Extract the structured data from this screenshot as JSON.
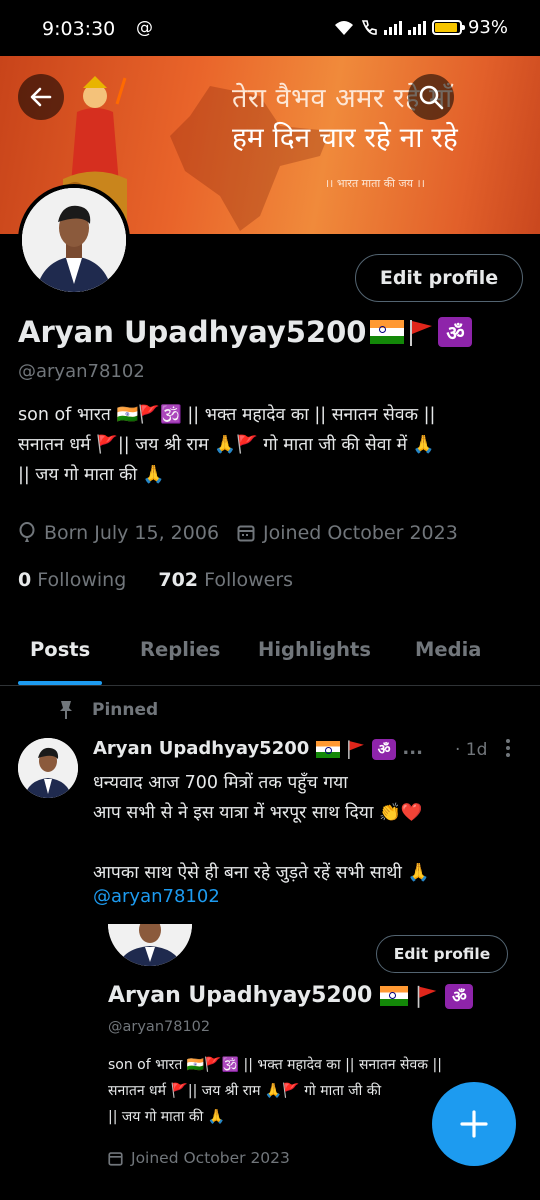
{
  "status_bar": {
    "time": "9:03:30",
    "at_symbol": "@",
    "battery": "93%",
    "battery_level": 0.93
  },
  "banner": {
    "line1": "तेरा वैभव अमर रहे माँ",
    "line2": "हम दिन चार रहे ना रहे",
    "line3": "।। भारत माता की जय ।।"
  },
  "profile": {
    "name": "Aryan Upadhyay5200",
    "handle": "@aryan78102",
    "edit_label": "Edit profile",
    "bio_line1": "son of भारत 🇮🇳🚩🕉️ || भक्त महादेव का || सनातन सेवक ||",
    "bio_line2": "सनातन धर्म 🚩|| जय श्री राम 🙏🚩 गो माता जी की सेवा में 🙏",
    "bio_line3": "|| जय गो माता की 🙏",
    "born": "Born July 15, 2006",
    "joined": "Joined October 2023",
    "following_count": "0",
    "following_label": "Following",
    "followers_count": "702",
    "followers_label": "Followers"
  },
  "tabs": [
    "Posts",
    "Replies",
    "Highlights",
    "Media"
  ],
  "post": {
    "pinned_label": "Pinned",
    "author": "Aryan Upadhyay5200",
    "ellipsis": "...",
    "time": "· 1d",
    "line1": "धन्यवाद आज 700  मित्रों तक पहुँच गया",
    "line2": "आप सभी से ने इस यात्रा में भरपूर साथ दिया 👏❤️",
    "line3": "आपका साथ ऐसे ही बना रहे जुड़ते रहें सभी साथी 🙏",
    "mention": "@aryan78102"
  },
  "embedded": {
    "edit_label": "Edit profile",
    "name": "Aryan Upadhyay5200",
    "handle": "@aryan78102",
    "bio_line1": "son of भारत 🇮🇳🚩🕉️ || भक्त महादेव का || सनातन सेवक ||",
    "bio_line2": "सनातन धर्म 🚩|| जय श्री राम 🙏🚩 गो माता जी की",
    "bio_line3": "|| जय गो माता की 🙏",
    "joined": "Joined October 2023"
  },
  "icons": {
    "back": "arrow-left-icon",
    "search": "search-icon",
    "compose": "plus-icon",
    "pin": "pin-icon",
    "location": "balloon-icon",
    "calendar": "calendar-icon",
    "more": "more-vertical-icon"
  },
  "colors": {
    "accent": "#1d9bf0",
    "muted": "#71767b",
    "banner": "#e9642a",
    "battery": "#f7c600"
  }
}
